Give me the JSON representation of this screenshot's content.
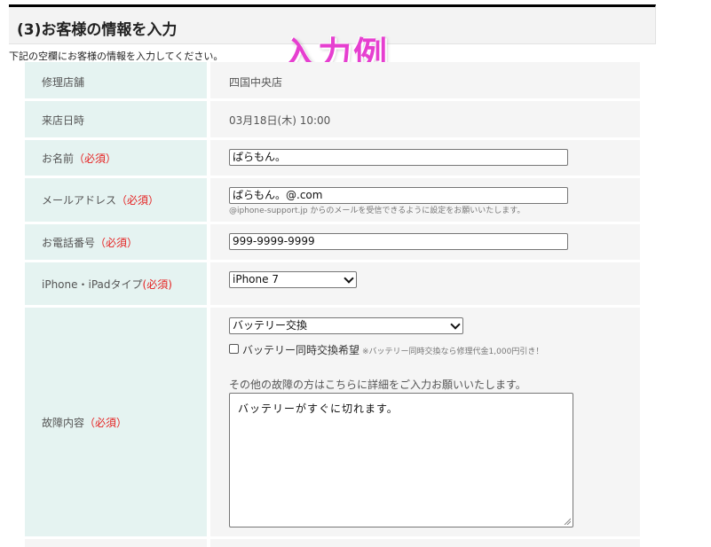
{
  "section": {
    "title": "(3)お客様の情報を入力",
    "example_label": "入力例",
    "intro": "下記の空欄にお客様の情報を入力してください。"
  },
  "form": {
    "store": {
      "label": "修理店舗",
      "value": "四国中央店"
    },
    "visit": {
      "label": "来店日時",
      "value": "03月18日(木) 10:00"
    },
    "name": {
      "label": "お名前",
      "required": "（必須）",
      "value": "ぱらもん。"
    },
    "email": {
      "label": "メールアドレス",
      "required": "（必須）",
      "value": "ぱらもん。@.com",
      "note": "@iphone-support.jp からのメールを受信できるように設定をお願いいたします。"
    },
    "phone": {
      "label": "お電話番号",
      "required": "（必須）",
      "value": "999-9999-9999"
    },
    "device": {
      "label": "iPhone・iPadタイプ",
      "required": "(必須)",
      "selected": "iPhone 7"
    },
    "issue": {
      "label": "故障内容",
      "required": "（必須）",
      "selected": "バッテリー交換",
      "checkbox_label": "バッテリー同時交換希望",
      "checkbox_checked": false,
      "checkbox_note": "※バッテリー同時交換なら修理代金1,000円引き！",
      "hint": "その他の故障の方はこちらに詳細をご入力お願いいたします。",
      "details": "バッテリーがすぐに切れます。"
    }
  }
}
